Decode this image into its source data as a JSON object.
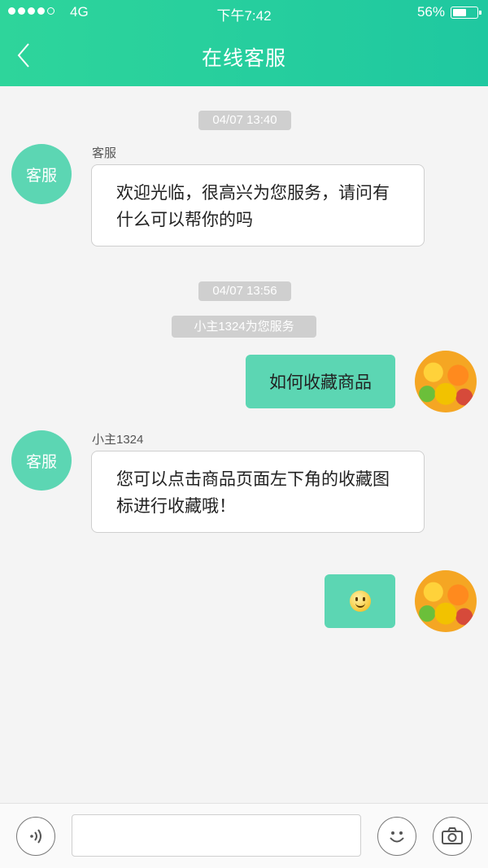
{
  "status_bar": {
    "network": "4G",
    "time": "下午7:42",
    "battery": "56%"
  },
  "header": {
    "title": "在线客服",
    "back_icon": "chevron-left-icon"
  },
  "chat": {
    "timestamp_1": "04/07 13:40",
    "agent_avatar_label": "客服",
    "msg1_sender": "客服",
    "msg1_text": "欢迎光临，很高兴为您服务，请问有什么可以帮你的吗",
    "timestamp_2": "04/07 13:56",
    "system_notice": "小主1324为您服务",
    "msg2_text": "如何收藏商品",
    "msg3_sender": "小主1324",
    "msg3_text": "您可以点击商品页面左下角的收藏图标进行收藏哦！",
    "msg4_emoji": "smile-emoji"
  },
  "input_bar": {
    "voice_icon": "voice-icon",
    "placeholder": "",
    "emoji_icon": "emoji-icon",
    "camera_icon": "camera-icon"
  },
  "colors": {
    "accent": "#1fc8a0",
    "bubble_out": "#5cd6b3",
    "timestamp_bg": "#cfcfcf"
  }
}
